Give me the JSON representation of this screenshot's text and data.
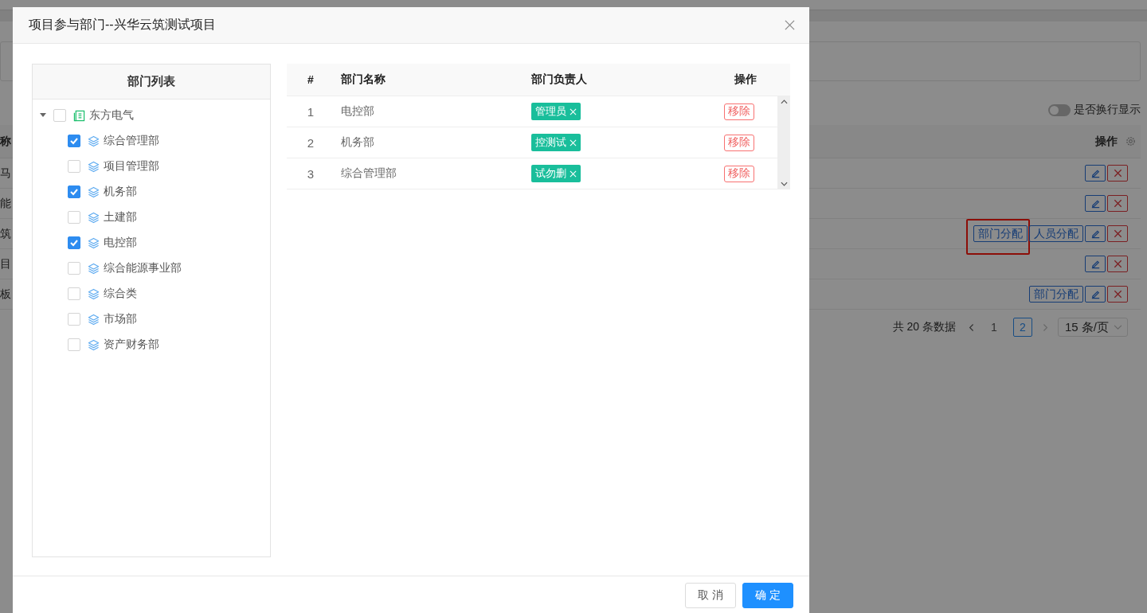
{
  "background": {
    "toggle": {
      "label": "是否换行显示",
      "on": false
    },
    "table": {
      "columns": [
        "称",
        "操作"
      ],
      "rows": [
        {
          "cell": "马",
          "actions": [
            {
              "kind": "edit"
            },
            {
              "kind": "delete"
            }
          ]
        },
        {
          "cell": "能",
          "actions": [
            {
              "kind": "edit"
            },
            {
              "kind": "delete"
            }
          ]
        },
        {
          "cell": "筑",
          "actions": [
            {
              "kind": "assign",
              "label": "部门分配",
              "highlighted": true
            },
            {
              "kind": "assign",
              "label": "人员分配",
              "highlighted": false
            },
            {
              "kind": "edit"
            },
            {
              "kind": "delete"
            }
          ]
        },
        {
          "cell": "目",
          "actions": [
            {
              "kind": "edit"
            },
            {
              "kind": "delete"
            }
          ]
        },
        {
          "cell": "板",
          "actions": [
            {
              "kind": "assign",
              "label": "部门分配",
              "highlighted": false
            },
            {
              "kind": "edit"
            },
            {
              "kind": "delete"
            }
          ]
        }
      ]
    },
    "pagination": {
      "total": "共 20 条数据",
      "pages": [
        {
          "label": "1",
          "selected": false
        },
        {
          "label": "2",
          "selected": true
        }
      ],
      "page_size": "15 条/页"
    }
  },
  "modal": {
    "title": "项目参与部门--兴华云筑测试项目",
    "tree": {
      "title": "部门列表",
      "root": {
        "label": "东方电气",
        "checked": false,
        "expanded": true,
        "children": [
          {
            "label": "综合管理部",
            "checked": true
          },
          {
            "label": "项目管理部",
            "checked": false
          },
          {
            "label": "机务部",
            "checked": true
          },
          {
            "label": "土建部",
            "checked": false
          },
          {
            "label": "电控部",
            "checked": true
          },
          {
            "label": "综合能源事业部",
            "checked": false
          },
          {
            "label": "综合类",
            "checked": false
          },
          {
            "label": "市场部",
            "checked": false
          },
          {
            "label": "资产财务部",
            "checked": false
          }
        ]
      }
    },
    "table": {
      "columns": [
        "#",
        "部门名称",
        "部门负责人",
        "操作"
      ],
      "rows": [
        {
          "index": "1",
          "name": "电控部",
          "leader": "管理员",
          "action": "移除"
        },
        {
          "index": "2",
          "name": "机务部",
          "leader": "控测试",
          "action": "移除"
        },
        {
          "index": "3",
          "name": "综合管理部",
          "leader": "试勿删",
          "action": "移除"
        }
      ]
    },
    "buttons": [
      {
        "kind": "cancel",
        "label": "取 消"
      },
      {
        "kind": "ok",
        "label": "确 定"
      }
    ]
  }
}
